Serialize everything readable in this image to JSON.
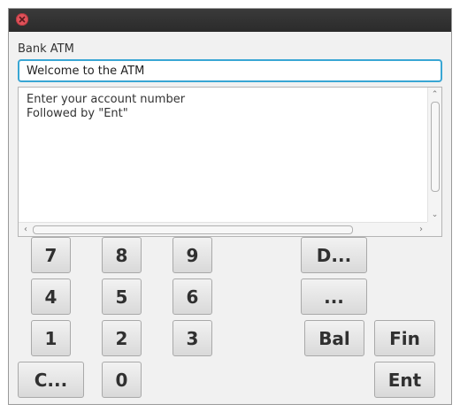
{
  "window": {
    "label": "Bank ATM"
  },
  "message_field": {
    "value": "Welcome to the ATM"
  },
  "output_area": {
    "text": "Enter your account number\nFollowed by \"Ent\""
  },
  "keypad": {
    "k7": "7",
    "k8": "8",
    "k9": "9",
    "k4": "4",
    "k5": "5",
    "k6": "6",
    "k1": "1",
    "k2": "2",
    "k3": "3",
    "k0": "0",
    "clear": "C...",
    "deposit": "D...",
    "withdraw": "...",
    "balance": "Bal",
    "finish": "Fin",
    "enter": "Ent"
  }
}
